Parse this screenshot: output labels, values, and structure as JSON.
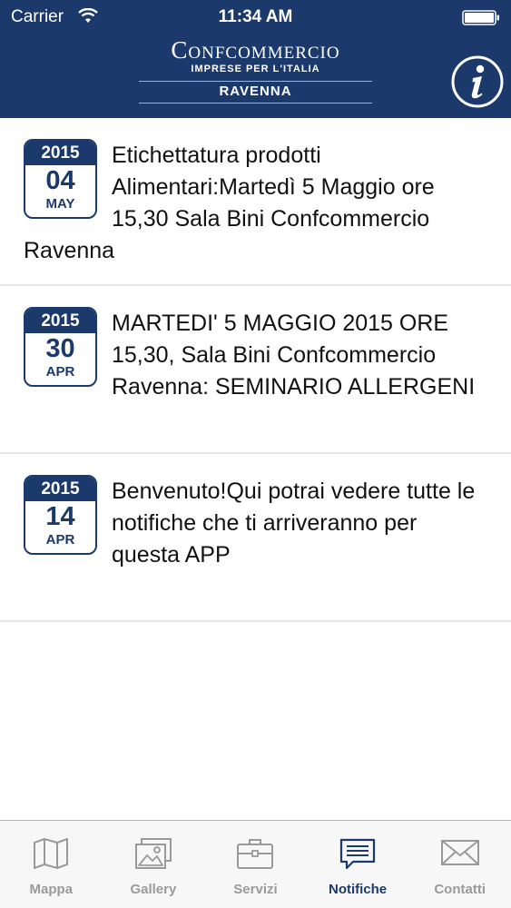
{
  "status_bar": {
    "carrier": "Carrier",
    "time": "11:34 AM"
  },
  "header": {
    "logo_title": "Confcommercio",
    "logo_subtitle": "IMPRESE PER L'ITALIA",
    "logo_city": "RAVENNA",
    "info_icon": "info-icon",
    "background_color": "#1b3a6b"
  },
  "notifications": [
    {
      "year": "2015",
      "day": "04",
      "month": "MAY",
      "text": "Etichettatura prodotti Alimentari:Martedì 5 Maggio ore 15,30 Sala Bini Confcommercio Ravenna"
    },
    {
      "year": "2015",
      "day": "30",
      "month": "APR",
      "text": "MARTEDI' 5 MAGGIO 2015 ORE 15,30, Sala Bini Confcommercio Ravenna: SEMINARIO ALLERGENI"
    },
    {
      "year": "2015",
      "day": "14",
      "month": "APR",
      "text": "Benvenuto!Qui potrai vedere tutte le notifiche che ti arriveranno per questa APP"
    }
  ],
  "tabs": [
    {
      "label": "Mappa",
      "icon": "map-icon"
    },
    {
      "label": "Gallery",
      "icon": "gallery-icon"
    },
    {
      "label": "Servizi",
      "icon": "briefcase-icon"
    },
    {
      "label": "Notifiche",
      "icon": "message-icon",
      "active": true
    },
    {
      "label": "Contatti",
      "icon": "envelope-icon"
    }
  ],
  "colors": {
    "accent": "#1b3a6b",
    "tab_inactive": "#9a9a9a",
    "divider": "#e6e6e6"
  }
}
